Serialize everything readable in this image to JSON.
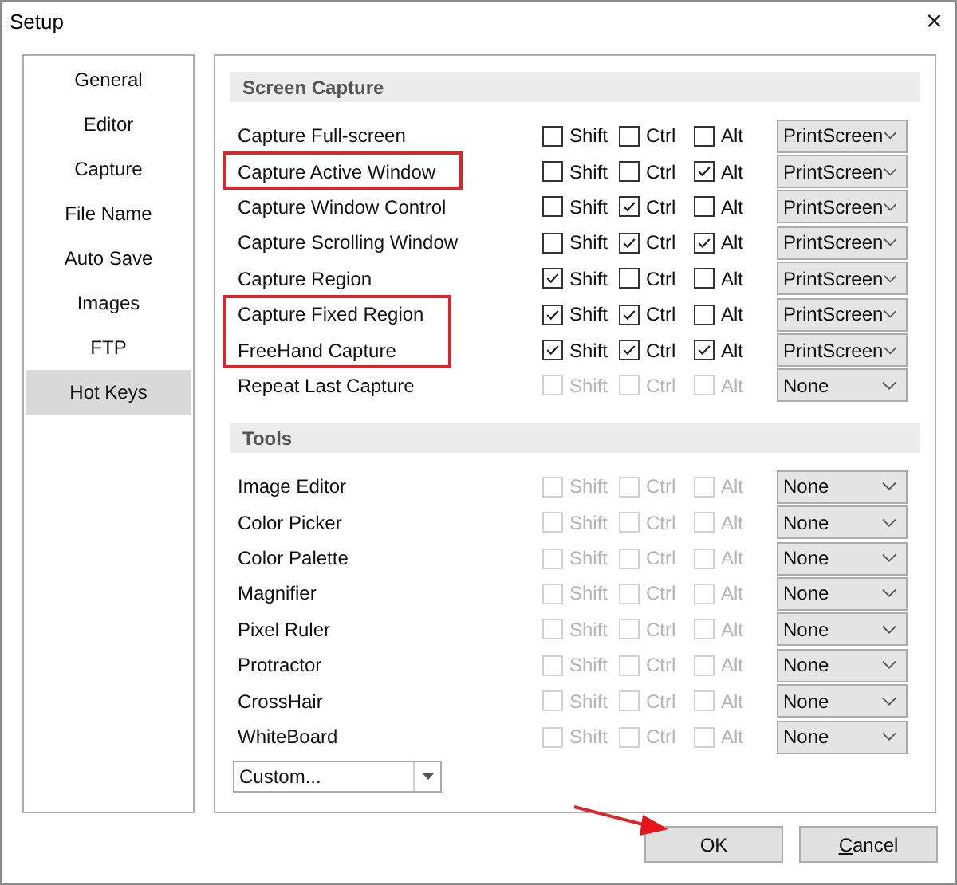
{
  "window": {
    "title": "Setup",
    "close": "×"
  },
  "sidebar": {
    "items": [
      {
        "label": "General",
        "selected": false
      },
      {
        "label": "Editor",
        "selected": false
      },
      {
        "label": "Capture",
        "selected": false
      },
      {
        "label": "File Name",
        "selected": false
      },
      {
        "label": "Auto Save",
        "selected": false
      },
      {
        "label": "Images",
        "selected": false
      },
      {
        "label": "FTP",
        "selected": false
      },
      {
        "label": "Hot Keys",
        "selected": true
      }
    ]
  },
  "sections": [
    {
      "title": "Screen Capture",
      "rows": [
        {
          "label": "Capture Full-screen",
          "highlighted": false,
          "disabled": false,
          "modifiers": [
            {
              "label": "Shift",
              "checked": false
            },
            {
              "label": "Ctrl",
              "checked": false
            },
            {
              "label": "Alt",
              "checked": false
            }
          ],
          "key": "PrintScreen"
        },
        {
          "label": "Capture Active Window",
          "highlighted": true,
          "disabled": false,
          "modifiers": [
            {
              "label": "Shift",
              "checked": false
            },
            {
              "label": "Ctrl",
              "checked": false
            },
            {
              "label": "Alt",
              "checked": true
            }
          ],
          "key": "PrintScreen"
        },
        {
          "label": "Capture Window Control",
          "highlighted": false,
          "disabled": false,
          "modifiers": [
            {
              "label": "Shift",
              "checked": false
            },
            {
              "label": "Ctrl",
              "checked": true
            },
            {
              "label": "Alt",
              "checked": false
            }
          ],
          "key": "PrintScreen"
        },
        {
          "label": "Capture Scrolling Window",
          "highlighted": false,
          "disabled": false,
          "modifiers": [
            {
              "label": "Shift",
              "checked": false
            },
            {
              "label": "Ctrl",
              "checked": true
            },
            {
              "label": "Alt",
              "checked": true
            }
          ],
          "key": "PrintScreen"
        },
        {
          "label": "Capture Region",
          "highlighted": false,
          "disabled": false,
          "modifiers": [
            {
              "label": "Shift",
              "checked": true
            },
            {
              "label": "Ctrl",
              "checked": false
            },
            {
              "label": "Alt",
              "checked": false
            }
          ],
          "key": "PrintScreen"
        },
        {
          "label": "Capture Fixed Region",
          "highlighted": true,
          "disabled": false,
          "modifiers": [
            {
              "label": "Shift",
              "checked": true
            },
            {
              "label": "Ctrl",
              "checked": true
            },
            {
              "label": "Alt",
              "checked": false
            }
          ],
          "key": "PrintScreen"
        },
        {
          "label": "FreeHand Capture",
          "highlighted": true,
          "disabled": false,
          "modifiers": [
            {
              "label": "Shift",
              "checked": true
            },
            {
              "label": "Ctrl",
              "checked": true
            },
            {
              "label": "Alt",
              "checked": true
            }
          ],
          "key": "PrintScreen"
        },
        {
          "label": "Repeat Last Capture",
          "highlighted": false,
          "disabled": true,
          "modifiers": [
            {
              "label": "Shift",
              "checked": false
            },
            {
              "label": "Ctrl",
              "checked": false
            },
            {
              "label": "Alt",
              "checked": false
            }
          ],
          "key": "None"
        }
      ]
    },
    {
      "title": "Tools",
      "rows": [
        {
          "label": "Image Editor",
          "highlighted": false,
          "disabled": true,
          "modifiers": [
            {
              "label": "Shift",
              "checked": false
            },
            {
              "label": "Ctrl",
              "checked": false
            },
            {
              "label": "Alt",
              "checked": false
            }
          ],
          "key": "None"
        },
        {
          "label": "Color Picker",
          "highlighted": false,
          "disabled": true,
          "modifiers": [
            {
              "label": "Shift",
              "checked": false
            },
            {
              "label": "Ctrl",
              "checked": false
            },
            {
              "label": "Alt",
              "checked": false
            }
          ],
          "key": "None"
        },
        {
          "label": "Color Palette",
          "highlighted": false,
          "disabled": true,
          "modifiers": [
            {
              "label": "Shift",
              "checked": false
            },
            {
              "label": "Ctrl",
              "checked": false
            },
            {
              "label": "Alt",
              "checked": false
            }
          ],
          "key": "None"
        },
        {
          "label": "Magnifier",
          "highlighted": false,
          "disabled": true,
          "modifiers": [
            {
              "label": "Shift",
              "checked": false
            },
            {
              "label": "Ctrl",
              "checked": false
            },
            {
              "label": "Alt",
              "checked": false
            }
          ],
          "key": "None"
        },
        {
          "label": "Pixel Ruler",
          "highlighted": false,
          "disabled": true,
          "modifiers": [
            {
              "label": "Shift",
              "checked": false
            },
            {
              "label": "Ctrl",
              "checked": false
            },
            {
              "label": "Alt",
              "checked": false
            }
          ],
          "key": "None"
        },
        {
          "label": "Protractor",
          "highlighted": false,
          "disabled": true,
          "modifiers": [
            {
              "label": "Shift",
              "checked": false
            },
            {
              "label": "Ctrl",
              "checked": false
            },
            {
              "label": "Alt",
              "checked": false
            }
          ],
          "key": "None"
        },
        {
          "label": "CrossHair",
          "highlighted": false,
          "disabled": true,
          "modifiers": [
            {
              "label": "Shift",
              "checked": false
            },
            {
              "label": "Ctrl",
              "checked": false
            },
            {
              "label": "Alt",
              "checked": false
            }
          ],
          "key": "None"
        },
        {
          "label": "WhiteBoard",
          "highlighted": false,
          "disabled": true,
          "modifiers": [
            {
              "label": "Shift",
              "checked": false
            },
            {
              "label": "Ctrl",
              "checked": false
            },
            {
              "label": "Alt",
              "checked": false
            }
          ],
          "key": "None"
        }
      ]
    }
  ],
  "preset": {
    "value": "Custom..."
  },
  "buttons": [
    {
      "kind": "ok",
      "label": "OK",
      "pointed_at": true
    },
    {
      "kind": "cancel",
      "label": "Cancel",
      "pointed_at": false
    }
  ]
}
